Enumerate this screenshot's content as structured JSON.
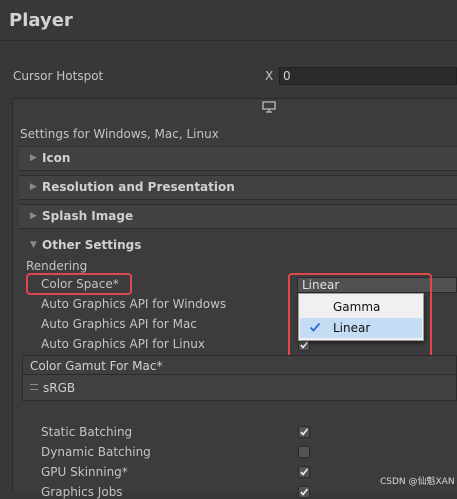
{
  "header": {
    "title": "Player"
  },
  "cursor": {
    "label": "Cursor Hotspot",
    "x_label": "X",
    "x_value": "0"
  },
  "platform": {
    "monitor_icon": "monitor-icon",
    "text": "Settings for Windows, Mac, Linux"
  },
  "sections": {
    "icon": "Icon",
    "resolution": "Resolution and Presentation",
    "splash": "Splash Image",
    "other": "Other Settings"
  },
  "rendering": {
    "header": "Rendering",
    "color_space_label": "Color Space*",
    "color_space_value": "Linear",
    "auto_windows": "Auto Graphics API  for Windows",
    "auto_mac": "Auto Graphics API  for Mac",
    "auto_linux": "Auto Graphics API  for Linux",
    "options": [
      "Gamma",
      "Linear"
    ],
    "selected_option": "Linear"
  },
  "gamut": {
    "header": "Color Gamut For Mac*",
    "items": [
      "sRGB"
    ]
  },
  "batching": {
    "static": "Static Batching",
    "dynamic": "Dynamic Batching",
    "gpu_skinning": "GPU Skinning*",
    "graphics_jobs": "Graphics Jobs"
  },
  "checks": {
    "static": true,
    "dynamic": false,
    "gpu_skinning": true,
    "graphics_jobs": true
  },
  "highlight_color": "#e0474c",
  "watermark": "CSDN @仙魁XAN"
}
